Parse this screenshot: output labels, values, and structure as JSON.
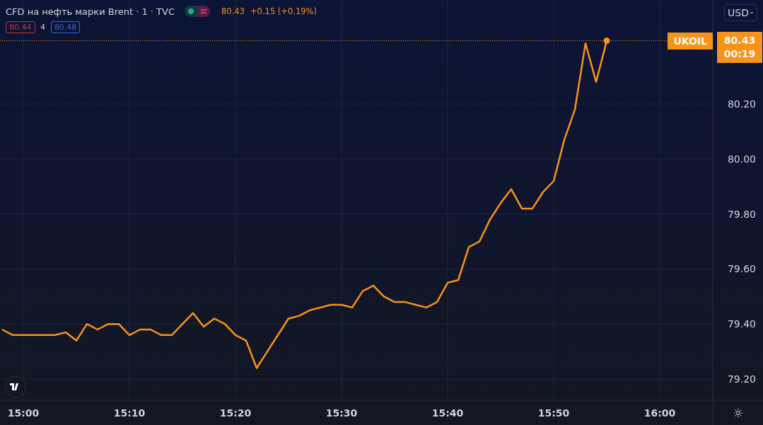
{
  "legend": {
    "title": "CFD на нефть марки Brent · 1 · TVC",
    "price": "80.43",
    "change": "+0.15 (+0.19%)",
    "bid": "80.44",
    "spread": "4",
    "ask": "80.48"
  },
  "currency": "USD",
  "last": {
    "price": "80.43",
    "countdown": "00:19"
  },
  "chart_data": {
    "type": "line",
    "categories": [
      null,
      null,
      "15:00",
      null,
      null,
      null,
      null,
      null,
      null,
      null,
      null,
      null,
      "15:10",
      null,
      null,
      null,
      null,
      null,
      null,
      null,
      null,
      null,
      "15:20",
      null,
      null,
      null,
      null,
      null,
      null,
      null,
      null,
      null,
      "15:30",
      null,
      null,
      null,
      null,
      null,
      null,
      null,
      null,
      null,
      "15:40",
      null,
      null,
      null,
      null,
      null,
      null,
      null,
      null,
      null,
      "15:50",
      null,
      null,
      null,
      null,
      null,
      null,
      null,
      null,
      null,
      "16:00",
      null,
      null,
      null,
      null
    ],
    "series": [
      {
        "name": "UKOIL",
        "color": "#f7931a",
        "values": [
          79.38,
          79.36,
          79.36,
          79.36,
          79.36,
          79.36,
          79.37,
          79.34,
          79.4,
          79.38,
          79.4,
          79.4,
          79.36,
          79.38,
          79.38,
          79.36,
          79.36,
          79.4,
          79.44,
          79.39,
          79.42,
          79.4,
          79.36,
          79.34,
          79.24,
          79.3,
          79.36,
          79.42,
          79.43,
          79.45,
          79.46,
          79.47,
          79.47,
          79.46,
          79.52,
          79.54,
          79.5,
          79.48,
          79.48,
          79.47,
          79.46,
          79.48,
          79.55,
          79.56,
          79.68,
          79.7,
          79.78,
          79.84,
          79.89,
          79.82,
          79.82,
          79.88,
          79.92,
          80.07,
          80.18,
          80.42,
          80.28,
          80.43,
          null,
          null,
          null,
          null,
          null,
          null,
          null,
          null,
          null
        ]
      }
    ],
    "ylim": [
      79.123,
      80.578
    ],
    "grid": true,
    "ref_lines": [
      {
        "axis": "y",
        "value": 80.43
      }
    ],
    "yticks": [
      {
        "value": 79.2,
        "label": "79.20"
      },
      {
        "value": 79.4,
        "label": "79.40"
      },
      {
        "value": 79.6,
        "label": "79.60"
      },
      {
        "value": 79.8,
        "label": "79.80"
      },
      {
        "value": 80.0,
        "label": "80.00"
      },
      {
        "value": 80.2,
        "label": "80.20"
      }
    ]
  }
}
